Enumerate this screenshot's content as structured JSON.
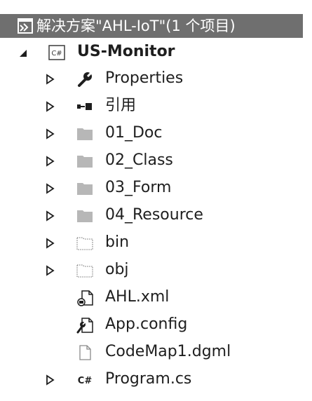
{
  "solution_explorer": {
    "solution": {
      "label": "解决方案\"AHL-IoT\"(1 个项目)",
      "icon": "solution-icon"
    },
    "project": {
      "label": "US-Monitor",
      "icon": "csharp-project-icon",
      "expanded": true
    },
    "items": [
      {
        "label": "Properties",
        "icon": "wrench-icon",
        "expandable": true
      },
      {
        "label": "引用",
        "icon": "references-icon",
        "expandable": true
      },
      {
        "label": "01_Doc",
        "icon": "folder-icon",
        "expandable": true
      },
      {
        "label": "02_Class",
        "icon": "folder-icon",
        "expandable": true
      },
      {
        "label": "03_Form",
        "icon": "folder-icon",
        "expandable": true
      },
      {
        "label": "04_Resource",
        "icon": "folder-icon",
        "expandable": true
      },
      {
        "label": "bin",
        "icon": "dotted-folder-icon",
        "expandable": true
      },
      {
        "label": "obj",
        "icon": "dotted-folder-icon",
        "expandable": true
      },
      {
        "label": "AHL.xml",
        "icon": "xml-file-icon",
        "expandable": false
      },
      {
        "label": "App.config",
        "icon": "config-file-icon",
        "expandable": false
      },
      {
        "label": "CodeMap1.dgml",
        "icon": "file-icon",
        "expandable": false
      },
      {
        "label": "Program.cs",
        "icon": "csharp-file-icon",
        "expandable": true
      }
    ]
  },
  "colors": {
    "selection_background": "#6f6f6f",
    "text": "#1e1e1e",
    "folder_gray": "#b7b7b7",
    "expander": "#1e1e1e"
  }
}
